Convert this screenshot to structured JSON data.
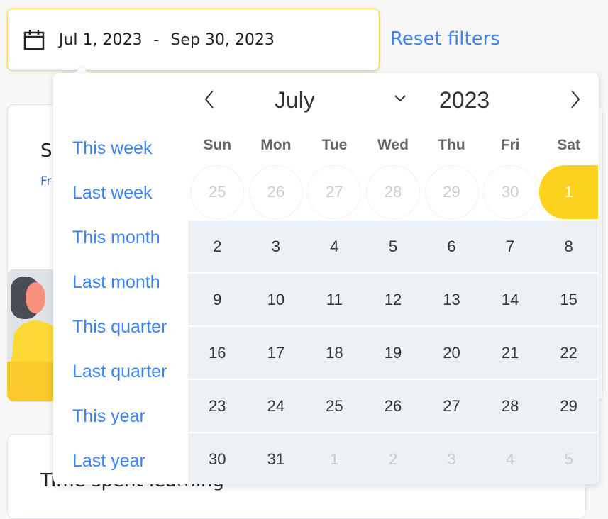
{
  "date_range": {
    "start": "Jul 1, 2023",
    "separator": "-",
    "end": "Sep 30, 2023",
    "icon": "calendar-icon"
  },
  "reset_label": "Reset filters",
  "background": {
    "card1_title": "S",
    "card1_sub": "Fr",
    "card2_title": "Time spent learning"
  },
  "picker": {
    "month": "July",
    "year": "2023",
    "presets": [
      "This week",
      "Last week",
      "This month",
      "Last month",
      "This quarter",
      "Last quarter",
      "This year",
      "Last year"
    ],
    "weekdays": [
      "Sun",
      "Mon",
      "Tue",
      "Wed",
      "Thu",
      "Fri",
      "Sat"
    ],
    "weeks": [
      [
        "25",
        "26",
        "27",
        "28",
        "29",
        "30",
        "1"
      ],
      [
        "2",
        "3",
        "4",
        "5",
        "6",
        "7",
        "8"
      ],
      [
        "9",
        "10",
        "11",
        "12",
        "13",
        "14",
        "15"
      ],
      [
        "16",
        "17",
        "18",
        "19",
        "20",
        "21",
        "22"
      ],
      [
        "23",
        "24",
        "25",
        "26",
        "27",
        "28",
        "29"
      ],
      [
        "30",
        "31",
        "1",
        "2",
        "3",
        "4",
        "5"
      ]
    ],
    "selected_start": "1",
    "accent": "#fdd21f",
    "link_color": "#3b82f6",
    "range_bg": "#ecf1f5"
  }
}
